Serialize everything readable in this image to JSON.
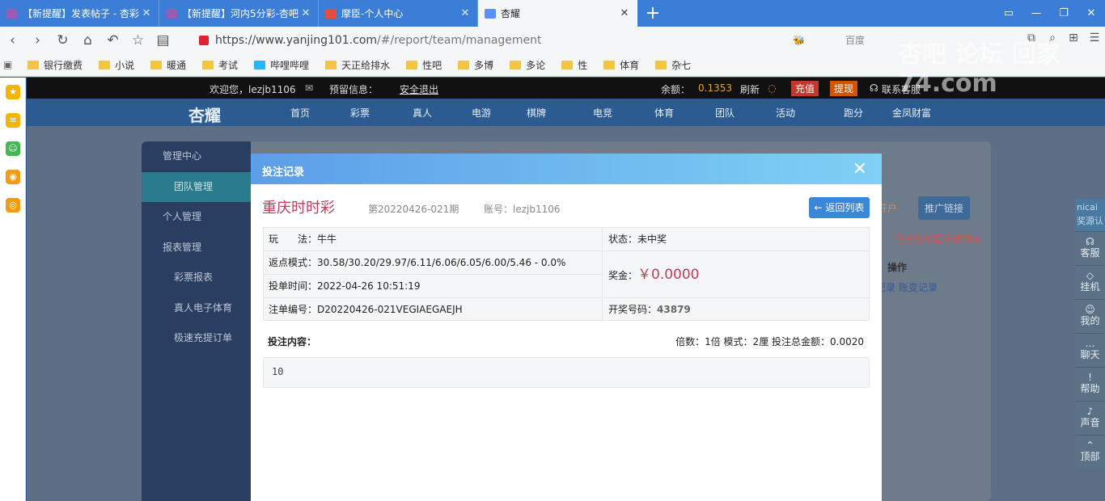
{
  "browser": {
    "tabs": [
      {
        "title": "【新提醒】发表帖子 - 杏彩",
        "fav_color": "#9b59b6"
      },
      {
        "title": "【新提醒】河内5分彩-杏吧",
        "fav_color": "#9b59b6"
      },
      {
        "title": "摩臣-个人中心",
        "fav_color": "#e74c3c"
      },
      {
        "title": "杏耀",
        "fav_color": "#5b8ff9"
      }
    ],
    "url_host": "https://www.yanjing101.com",
    "url_path": "/#/report/team/management",
    "search_placeholder": "百度",
    "bookmarks": [
      "银行缴费",
      "小说",
      "暖通",
      "考试",
      "哔哩哔哩",
      "天正给排水",
      "性吧",
      "多博",
      "多论",
      "性",
      "体育",
      "杂七"
    ]
  },
  "site": {
    "welcome": "欢迎您，lezjb1106",
    "reserved_info": "预留信息：",
    "logout": "安全退出",
    "balance_label": "余额：",
    "balance": "0.1353",
    "refresh": "刷新",
    "deposit": "充值",
    "withdraw": "提现",
    "support": "联系客服",
    "logo": "杏耀",
    "nav": [
      "首页",
      "彩票",
      "真人",
      "电游",
      "棋牌",
      "电竞",
      "体育",
      "团队",
      "活动",
      "跑分",
      "金凤财富"
    ],
    "sidebar": {
      "mgmt": "管理中心",
      "team": "团队管理",
      "personal": "个人管理",
      "report": "报表管理",
      "lottery_report": "彩票报表",
      "live_report": "真人电子体育",
      "fast_order": "极速充提订单"
    },
    "bg_open_account": "开户",
    "bg_promo": "推广链接",
    "bg_hint": "可点击标题修改排序",
    "bg_op": "操作",
    "bg_links": "记录  账变记录",
    "right_float": {
      "head": "nicai奖源认",
      "items": [
        "客服",
        "挂机",
        "我的",
        "聊天",
        "帮助",
        "声音",
        "顶部"
      ]
    }
  },
  "modal": {
    "title": "投注记录",
    "lottery": "重庆时时彩",
    "issue": "第20220426-021期",
    "account": "账号：lezjb1106",
    "back_btn": "返回列表",
    "play": "玩　　法：牛牛",
    "status": "状态：未中奖",
    "rebate": "返点模式：30.58/30.20/29.97/6.11/6.06/6.05/6.00/5.46 - 0.0%",
    "prize_label": "奖金：",
    "prize": "￥0.0000",
    "time": "投单时间：2022-04-26 10:51:19",
    "order_no": "注单编号：D20220426-021VEGIAEGAEJH",
    "draw_label": "开奖号码：",
    "draw": "43879",
    "content_label": "投注内容：",
    "meta": "倍数：1倍   模式：2厘   投注总金额：0.0020",
    "content": "10"
  },
  "watermark": "杏吧 论坛 回家74.com"
}
